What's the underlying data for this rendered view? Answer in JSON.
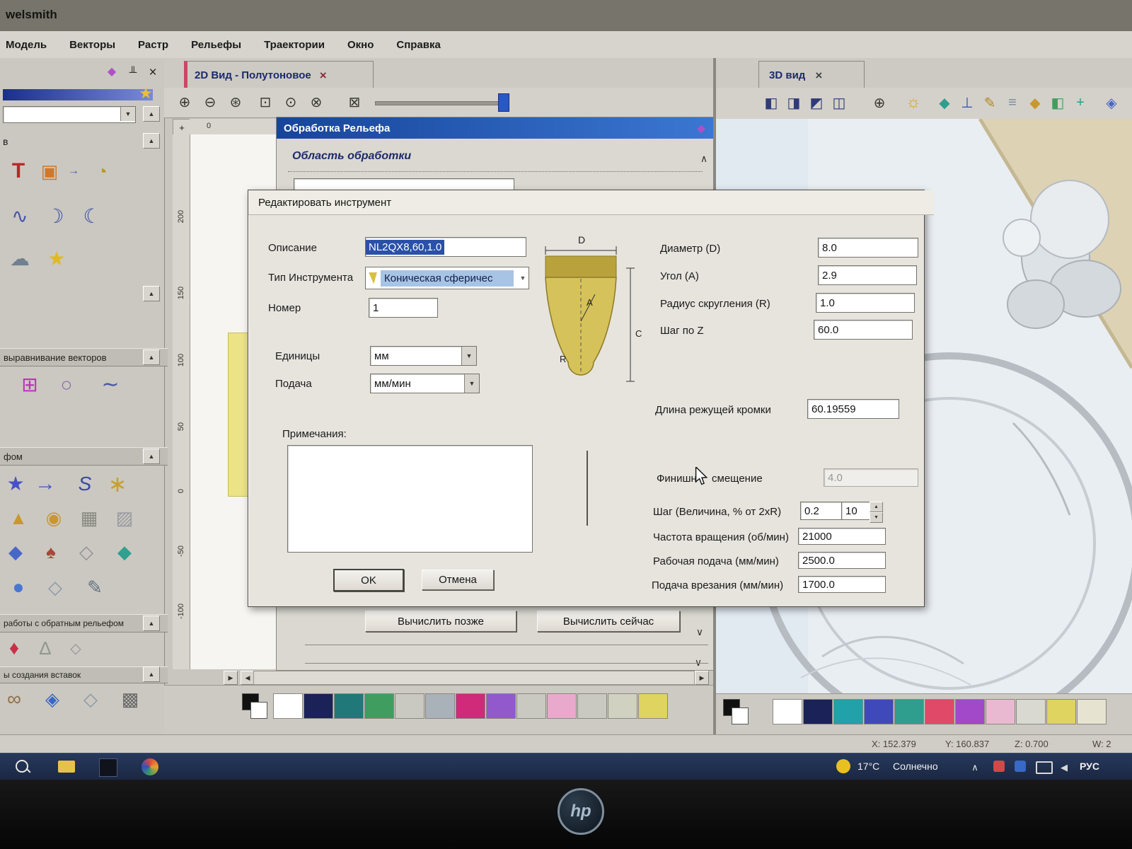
{
  "titlebar": {
    "app_title": "welsmith"
  },
  "menu": {
    "items": [
      "Модель",
      "Векторы",
      "Растр",
      "Рельефы",
      "Траектории",
      "Окно",
      "Справка"
    ]
  },
  "panel2d": {
    "tab": "2D Вид - Полутоновое",
    "ruler_origin": "0",
    "ruler_ticks": [
      "200",
      "150",
      "100",
      "50",
      "0",
      "-50",
      "-100"
    ]
  },
  "panel3d": {
    "tab": "3D вид"
  },
  "relief": {
    "title": "Обработка Рельефа",
    "section": "Область обработки",
    "calc_later": "Вычислить позже",
    "calc_now": "Вычислить сейчас"
  },
  "left_panel": {
    "label_v": "в",
    "section_align": "выравнивание векторов",
    "section_transform": "фом",
    "section_reverse": "работы с обратным рельефом",
    "section_inserts": "ы создания вставок"
  },
  "dialog": {
    "title": "Редактировать инструмент",
    "description_label": "Описание",
    "description_value": "NL2QX8,60,1.0",
    "tool_type_label": "Тип Инструмента",
    "tool_type_value": "Коническая сферичес",
    "number_label": "Номер",
    "number_value": "1",
    "units_label": "Единицы",
    "units_value": "мм",
    "feed_label": "Подача",
    "feed_value": "мм/мин",
    "notes_label": "Примечания:",
    "diameter_label": "Диаметр (D)",
    "diameter_value": "8.0",
    "angle_label": "Угол (А)",
    "angle_value": "2.9",
    "radius_label": "Радиус скругления (R)",
    "radius_value": "1.0",
    "step_z_label": "Шаг по Z",
    "step_z_value": "60.0",
    "edge_length_label": "Длина режущей кромки",
    "edge_length_value": "60.19559",
    "finish_label_a": "Финишн",
    "finish_label_b": "смещение",
    "finish_value": "4.0",
    "step_label": "Шаг (Величина, % от 2xR)",
    "step_value": "0.2",
    "step_percent_value": "10",
    "rpm_label": "Частота вращения (об/мин)",
    "rpm_value": "21000",
    "work_feed_label": "Рабочая подача (мм/мин)",
    "work_feed_value": "2500.0",
    "plunge_feed_label": "Подача врезания (мм/мин)",
    "plunge_feed_value": "1700.0",
    "ok_label": "OK",
    "cancel_label": "Отмена",
    "diagram": {
      "d": "D",
      "a": "A",
      "c": "C",
      "r": "R"
    }
  },
  "status": {
    "x": "X: 152.379",
    "y": "Y: 160.837",
    "z": "Z: 0.700",
    "w": "W: 2"
  },
  "taskbar": {
    "temp": "17°C",
    "weather": "Солнечно",
    "lang": "РУС"
  },
  "bezel": {
    "logo": "hp"
  },
  "colors": {
    "palette_2d": [
      "#ffffff",
      "#1a2258",
      "#217878",
      "#3f9e5f",
      "#c9c9c1",
      "#a9b1b9",
      "#d02a7a",
      "#9159cc",
      "#c9c9c1",
      "#e9a9cd",
      "#c9c9c1",
      "#d1d1c1",
      "#ded45f"
    ],
    "palette_3d": [
      "#ffffff",
      "#1a2258",
      "#21a1a9",
      "#4049b9",
      "#2f9e8f",
      "#e14969",
      "#a149c9",
      "#e9b9d1",
      "#d9d9d1",
      "#ded45f",
      "#e7e3d1"
    ]
  },
  "icons": {
    "close": {
      "g": "×",
      "c": "#22221e"
    },
    "pin": {
      "g": "╨",
      "c": "#33332d"
    },
    "gem": {
      "g": "◆",
      "c": "#b050c8"
    },
    "star": {
      "g": "★",
      "c": "#e8c030"
    },
    "up": {
      "g": "▲",
      "c": "#33332d"
    },
    "down": {
      "g": "▼",
      "c": "#33332d"
    },
    "left": {
      "g": "◀",
      "c": "#33332d"
    },
    "right": {
      "g": "▶",
      "c": "#33332d"
    },
    "chev_up": {
      "g": "∧",
      "c": "#33332d"
    },
    "chev_down": {
      "g": "∨",
      "c": "#33332d"
    },
    "corner": {
      "g": "+",
      "c": "#33332d"
    },
    "larrow": {
      "g": "↳",
      "c": "#33332d"
    },
    "z1": {
      "g": "⊕",
      "c": "#3a3a34"
    },
    "z2": {
      "g": "⊖",
      "c": "#3a3a34"
    },
    "z3": {
      "g": "⊛",
      "c": "#3a3a34"
    },
    "z4": {
      "g": "⊡",
      "c": "#3a3a34"
    },
    "z5": {
      "g": "⊙",
      "c": "#3a3a34"
    },
    "z6": {
      "g": "⊗",
      "c": "#3a3a34"
    },
    "z7": {
      "g": "⊠",
      "c": "#3a3a34"
    },
    "text": {
      "g": "T",
      "c": "#b82828"
    },
    "paint": {
      "g": "▣",
      "c": "#d07828"
    },
    "curve": {
      "g": "→",
      "c": "#4858a8"
    },
    "measure": {
      "g": "◔",
      "c": "#b89828"
    },
    "wave": {
      "g": "∿",
      "c": "#4858a8"
    },
    "moon1": {
      "g": "☽",
      "c": "#3850a0"
    },
    "moon2": {
      "g": "☾",
      "c": "#3850a0"
    },
    "cloud": {
      "g": "☁",
      "c": "#708090"
    },
    "star2": {
      "g": "★",
      "c": "#e0b828"
    },
    "sq_pair": {
      "g": "⊞",
      "c": "#c030c0"
    },
    "circles": {
      "g": "○",
      "c": "#8868a8"
    },
    "curve2": {
      "g": "∼",
      "c": "#4858a8"
    },
    "star_blue": {
      "g": "★",
      "c": "#4850c8"
    },
    "arrow_blue": {
      "g": "→",
      "c": "#4850c8"
    },
    "s_tool": {
      "g": "S",
      "c": "#3848a8"
    },
    "knot": {
      "g": "∗",
      "c": "#c8a030"
    },
    "pyramid": {
      "g": "▲",
      "c": "#c89830"
    },
    "coins": {
      "g": "◉",
      "c": "#c89830"
    },
    "grid": {
      "g": "▦",
      "c": "#888880"
    },
    "fabric": {
      "g": "▨",
      "c": "#9898a0"
    },
    "diam_blue": {
      "g": "◆",
      "c": "#4868c8"
    },
    "tree": {
      "g": "♠",
      "c": "#a84838"
    },
    "shapes": {
      "g": "◇",
      "c": "#909098"
    },
    "diam_teal": {
      "g": "◆",
      "c": "#30a090"
    },
    "sphere": {
      "g": "●",
      "c": "#4878d0"
    },
    "diam_out": {
      "g": "◇",
      "c": "#8898a8"
    },
    "pen": {
      "g": "✎",
      "c": "#607080"
    },
    "relief_red": {
      "g": "♦",
      "c": "#c83048"
    },
    "pyramids": {
      "g": "∆",
      "c": "#909890"
    },
    "rings": {
      "g": "∞",
      "c": "#907048"
    },
    "gem_info": {
      "g": "◈",
      "c": "#3868c8"
    },
    "pattern": {
      "g": "▩",
      "c": "#686868"
    },
    "cube1": {
      "g": "◧",
      "c": "#303a78"
    },
    "cube2": {
      "g": "◨",
      "c": "#303a78"
    },
    "cube3": {
      "g": "◩",
      "c": "#303a78"
    },
    "cube4": {
      "g": "◫",
      "c": "#303a78"
    },
    "bulb": {
      "g": "☼",
      "c": "#d8a820"
    },
    "t1": {
      "g": "◆",
      "c": "#2e9e8e"
    },
    "t2": {
      "g": "⊥",
      "c": "#3050c0"
    },
    "t3": {
      "g": "✎",
      "c": "#b08828"
    },
    "t4": {
      "g": "≡",
      "c": "#7a8a98"
    },
    "t5": {
      "g": "◆",
      "c": "#c89830"
    },
    "t6": {
      "g": "◧",
      "c": "#3e9e5e"
    },
    "t7": {
      "g": "+",
      "c": "#2e9e8e"
    },
    "t8": {
      "g": "◈",
      "c": "#4868c8"
    }
  }
}
